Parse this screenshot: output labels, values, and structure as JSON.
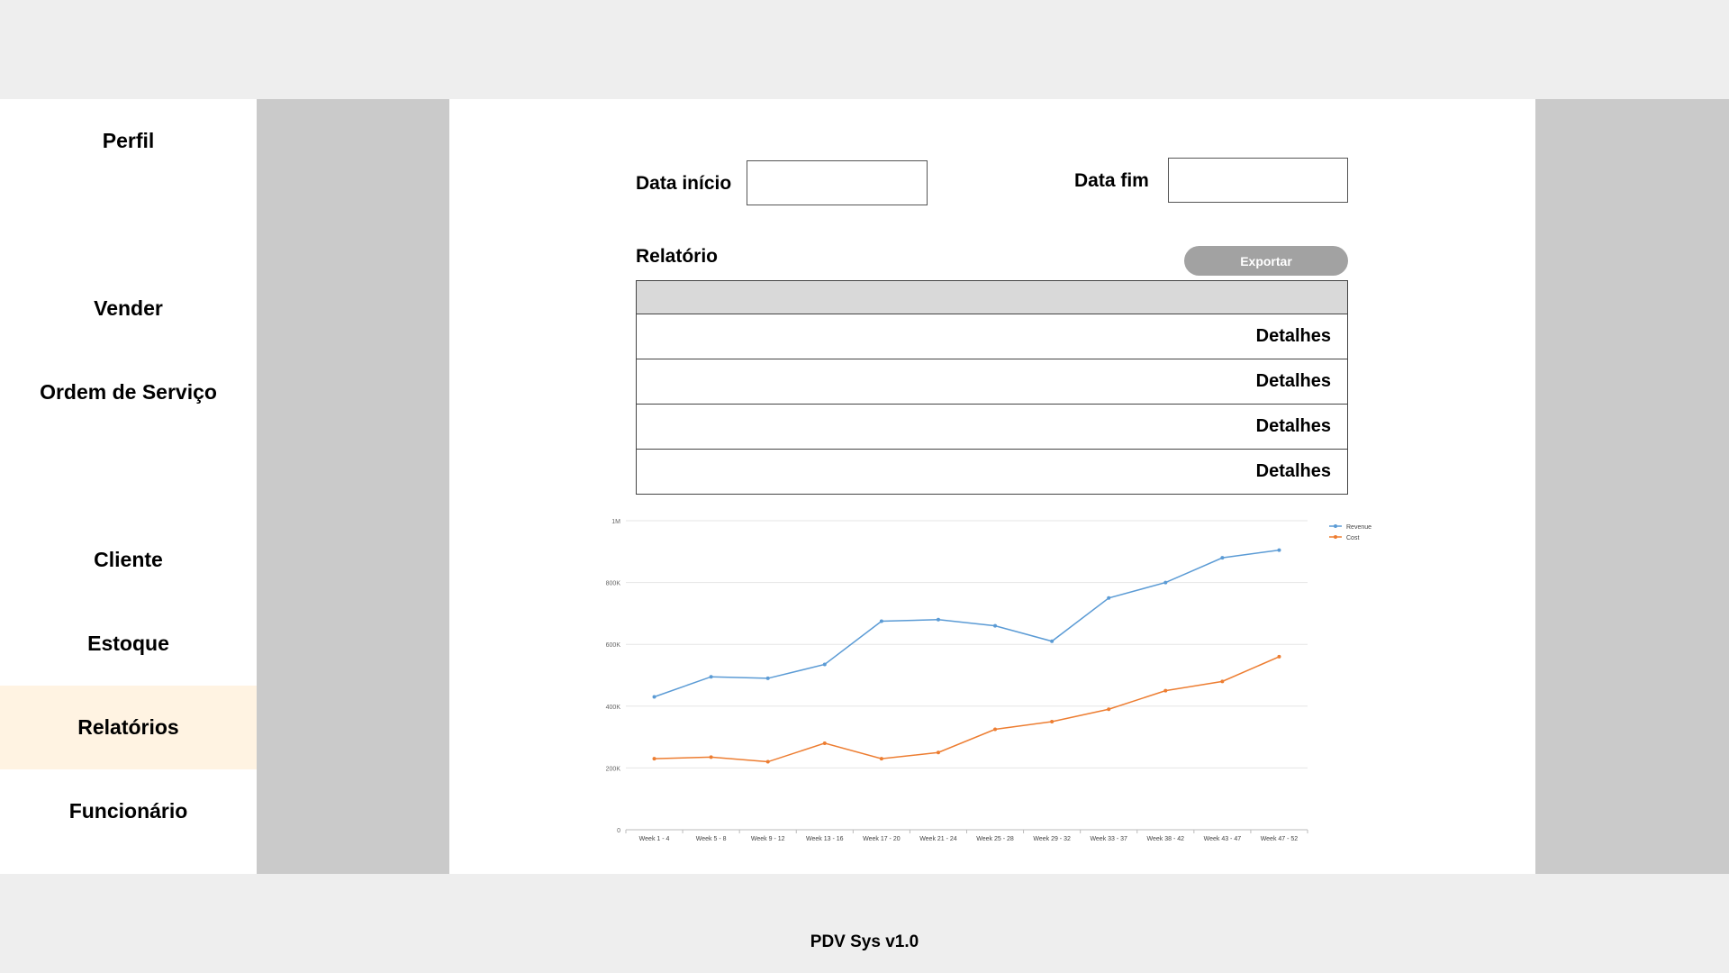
{
  "sidebar": {
    "items": [
      {
        "label": "Perfil"
      },
      {
        "label": "Vender"
      },
      {
        "label": "Ordem de Serviço"
      },
      {
        "label": "Cliente"
      },
      {
        "label": "Estoque"
      },
      {
        "label": "Relatórios",
        "active": true
      },
      {
        "label": "Funcionário"
      }
    ],
    "active_color": "#fff3e2"
  },
  "filters": {
    "start_label": "Data início",
    "start_value": "",
    "end_label": "Data fim",
    "end_value": ""
  },
  "report": {
    "title": "Relatório",
    "export_label": "Exportar",
    "rows": [
      {
        "details_label": "Detalhes"
      },
      {
        "details_label": "Detalhes"
      },
      {
        "details_label": "Detalhes"
      },
      {
        "details_label": "Detalhes"
      }
    ]
  },
  "chart_data": {
    "type": "line",
    "categories": [
      "Week 1 - 4",
      "Week 5 - 8",
      "Week 9 - 12",
      "Week 13 - 16",
      "Week 17 - 20",
      "Week 21 - 24",
      "Week 25 - 28",
      "Week 29 - 32",
      "Week 33 - 37",
      "Week 38 - 42",
      "Week 43 - 47",
      "Week 47 - 52"
    ],
    "series": [
      {
        "name": "Revenue",
        "color": "#5b9bd5",
        "values": [
          430000,
          495000,
          490000,
          535000,
          675000,
          680000,
          660000,
          610000,
          750000,
          800000,
          880000,
          905000
        ]
      },
      {
        "name": "Cost",
        "color": "#ed7d31",
        "values": [
          230000,
          235000,
          220000,
          280000,
          230000,
          250000,
          325000,
          350000,
          390000,
          450000,
          480000,
          560000
        ]
      }
    ],
    "yticks": [
      {
        "value": 0,
        "label": "0"
      },
      {
        "value": 200000,
        "label": "200K"
      },
      {
        "value": 400000,
        "label": "400K"
      },
      {
        "value": 600000,
        "label": "600K"
      },
      {
        "value": 800000,
        "label": "800K"
      },
      {
        "value": 1000000,
        "label": "1M"
      }
    ],
    "ylim": [
      0,
      1000000
    ],
    "grid": true,
    "legend_position": "top-right"
  },
  "footer": {
    "text": "PDV Sys v1.0"
  }
}
